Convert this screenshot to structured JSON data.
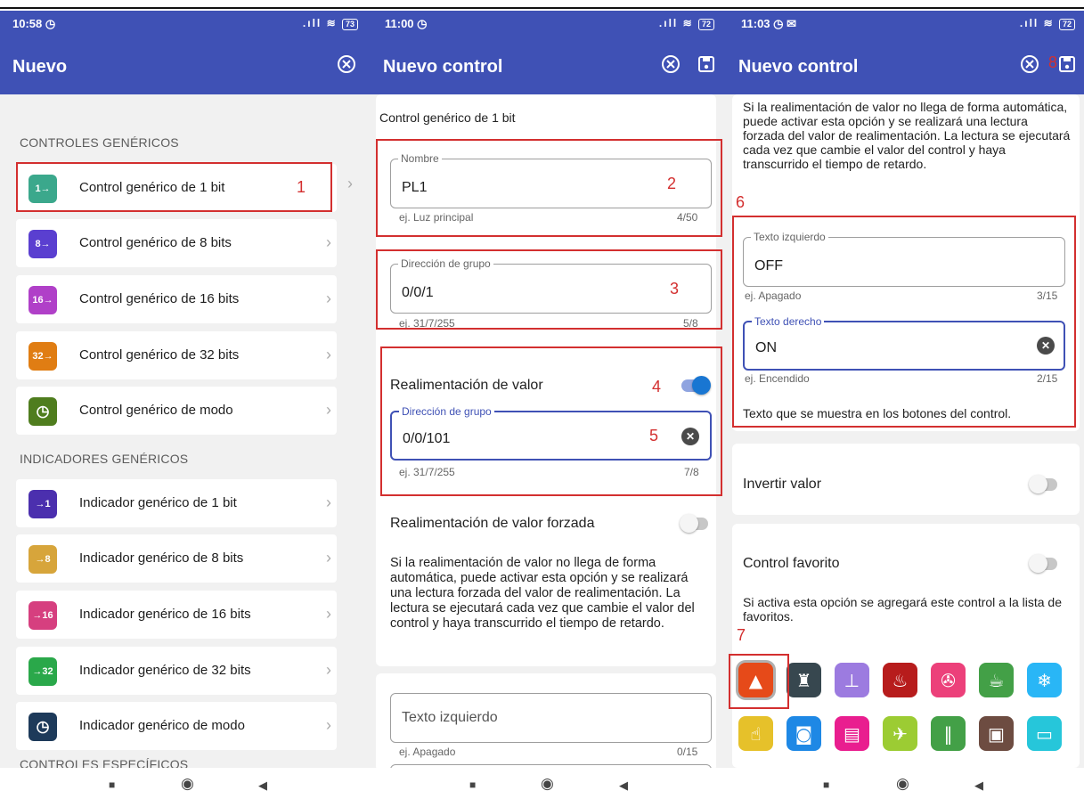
{
  "screen1": {
    "status": {
      "time": "10:58 ◷",
      "battery": "73"
    },
    "title": "Nuevo",
    "sections": [
      {
        "header": "CONTROLES GENÉRICOS",
        "items": [
          {
            "label": "Control genérico de 1 bit",
            "badge": "1→",
            "color": "#3ba88c"
          },
          {
            "label": "Control genérico de 8 bits",
            "badge": "8→",
            "color": "#5a3fd0"
          },
          {
            "label": "Control genérico de 16 bits",
            "badge": "16→",
            "color": "#b040c8"
          },
          {
            "label": "Control genérico de 32 bits",
            "badge": "32→",
            "color": "#e07d13"
          },
          {
            "label": "Control genérico de modo",
            "badge": "◷",
            "color": "#4f7d1e"
          }
        ]
      },
      {
        "header": "INDICADORES GENÉRICOS",
        "items": [
          {
            "label": "Indicador genérico de 1 bit",
            "badge": "→1",
            "color": "#4b2fae"
          },
          {
            "label": "Indicador genérico de 8 bits",
            "badge": "→8",
            "color": "#d7a53b"
          },
          {
            "label": "Indicador genérico de 16 bits",
            "badge": "→16",
            "color": "#d63f7f"
          },
          {
            "label": "Indicador genérico de 32 bits",
            "badge": "→32",
            "color": "#2aa84a"
          },
          {
            "label": "Indicador genérico de modo",
            "badge": "◷",
            "color": "#1d3a5a"
          }
        ]
      },
      {
        "header": "CONTROLES ESPECÍFICOS"
      }
    ],
    "marker": "1"
  },
  "screen2": {
    "status": {
      "time": "11:00 ◷",
      "battery": "72"
    },
    "title": "Nuevo control",
    "subtitle": "Control genérico de 1 bit",
    "name_field": {
      "label": "Nombre",
      "value": "PL1",
      "helper": "ej. Luz principal",
      "counter": "4/50"
    },
    "group_field": {
      "label": "Dirección de grupo",
      "value": "0/0/1",
      "helper": "ej. 31/7/255",
      "counter": "5/8"
    },
    "feedback": {
      "label": "Realimentación de valor",
      "enabled": true,
      "field": {
        "label": "Dirección de grupo",
        "value": "0/0/101",
        "helper": "ej. 31/7/255",
        "counter": "7/8"
      }
    },
    "forced": {
      "label": "Realimentación de valor forzada",
      "enabled": false,
      "desc": "Si la realimentación de valor no llega de forma automática, puede activar esta opción y se realizará una lectura forzada del valor de realimentación. La lectura se ejecutará cada vez que cambie el valor del control y haya transcurrido el tiempo de retardo."
    },
    "left_text": {
      "placeholder": "Texto izquierdo",
      "helper": "ej. Apagado",
      "counter": "0/15"
    },
    "markers": [
      "2",
      "3",
      "4",
      "5"
    ]
  },
  "screen3": {
    "status": {
      "time": "11:03 ◷ ✉",
      "battery": "72"
    },
    "title": "Nuevo control",
    "top_desc": "Si la realimentación de valor no llega de forma automática, puede activar esta opción y se realizará una lectura forzada del valor de realimentación. La lectura se ejecutará cada vez que cambie el valor del control y haya transcurrido el tiempo de retardo.",
    "left_field": {
      "label": "Texto izquierdo",
      "value": "OFF",
      "helper": "ej. Apagado",
      "counter": "3/15"
    },
    "right_field": {
      "label": "Texto derecho",
      "value": "ON",
      "helper": "ej. Encendido",
      "counter": "2/15"
    },
    "buttons_note": "Texto que se muestra en los botones del control.",
    "invert": {
      "label": "Invertir valor",
      "enabled": false
    },
    "favorite": {
      "label": "Control favorito",
      "enabled": false,
      "desc": "Si activa esta opción se agregará este control a la lista de favoritos."
    },
    "icons_row1": [
      {
        "name": "lamp-icon",
        "color": "#e64a19",
        "glyph": "▲"
      },
      {
        "name": "garden-light-icon",
        "color": "#37474f",
        "glyph": "♜"
      },
      {
        "name": "table-lamp-icon",
        "color": "#9c7be0",
        "glyph": "⊥"
      },
      {
        "name": "fire-icon",
        "color": "#b71c1c",
        "glyph": "♨"
      },
      {
        "name": "fan-icon",
        "color": "#ec407a",
        "glyph": "✇"
      },
      {
        "name": "coffee-machine-icon",
        "color": "#43a047",
        "glyph": "☕"
      },
      {
        "name": "snowflake-icon",
        "color": "#29b6f6",
        "glyph": "❄"
      }
    ],
    "icons_row2": [
      {
        "name": "tap-icon",
        "color": "#e6c12a",
        "glyph": "☝"
      },
      {
        "name": "washing-machine-icon",
        "color": "#1e88e5",
        "glyph": "◙"
      },
      {
        "name": "awning-icon",
        "color": "#e91e8f",
        "glyph": "▤"
      },
      {
        "name": "sprinkler-icon",
        "color": "#9ccc33",
        "glyph": "✈"
      },
      {
        "name": "blinds-icon",
        "color": "#43a047",
        "glyph": "‖"
      },
      {
        "name": "dishwasher-icon",
        "color": "#6d4c41",
        "glyph": "▣"
      },
      {
        "name": "monitor-icon",
        "color": "#26c6da",
        "glyph": "▭"
      }
    ],
    "markers": [
      "6",
      "7",
      "8"
    ]
  }
}
